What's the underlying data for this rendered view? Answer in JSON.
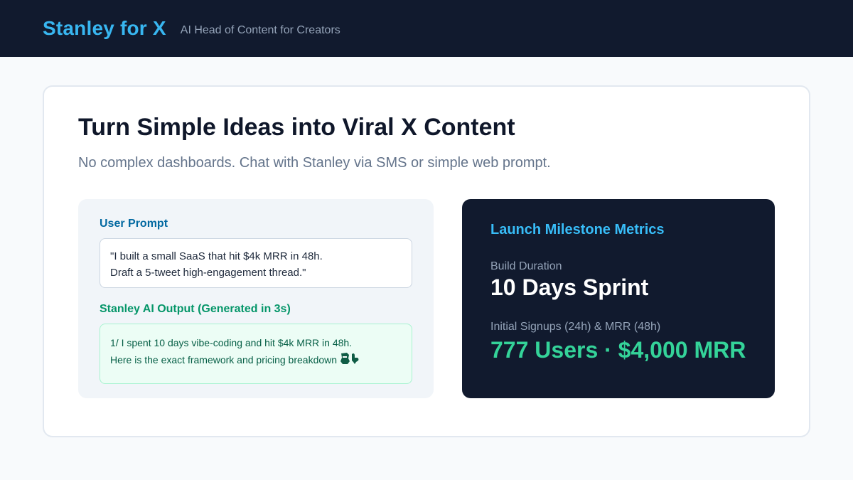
{
  "header": {
    "brand": "Stanley for X",
    "tagline": "AI Head of Content for Creators"
  },
  "main": {
    "headline": "Turn Simple Ideas into Viral X Content",
    "subhead": "No complex dashboards. Chat with Stanley via SMS or simple web prompt."
  },
  "prompt_panel": {
    "user_label": "User Prompt",
    "prompt_line_1": "\"I built a small SaaS that hit $4k MRR in 48h.",
    "prompt_line_2": "Draft a 5-tweet high-engagement thread.\"",
    "ai_label": "Stanley AI Output (Generated in 3s)",
    "output_line_1": "1/ I spent 10 days vibe-coding and hit $4k MRR in 48h.",
    "output_line_2": "Here is the exact framework and pricing breakdown",
    "output_emoji": "thread-down-pointing-icon"
  },
  "metrics": {
    "title": "Launch Milestone Metrics",
    "build_label": "Build Duration",
    "build_value": "10 Days Sprint",
    "signups_label": "Initial Signups (24h) & MRR (48h)",
    "signups_value": "777 Users · $4,000 MRR"
  },
  "colors": {
    "header_bg": "#111a2e",
    "brand": "#38b6f0",
    "user_label": "#0369a1",
    "ai_label": "#059669",
    "metric_highlight": "#34d399"
  }
}
